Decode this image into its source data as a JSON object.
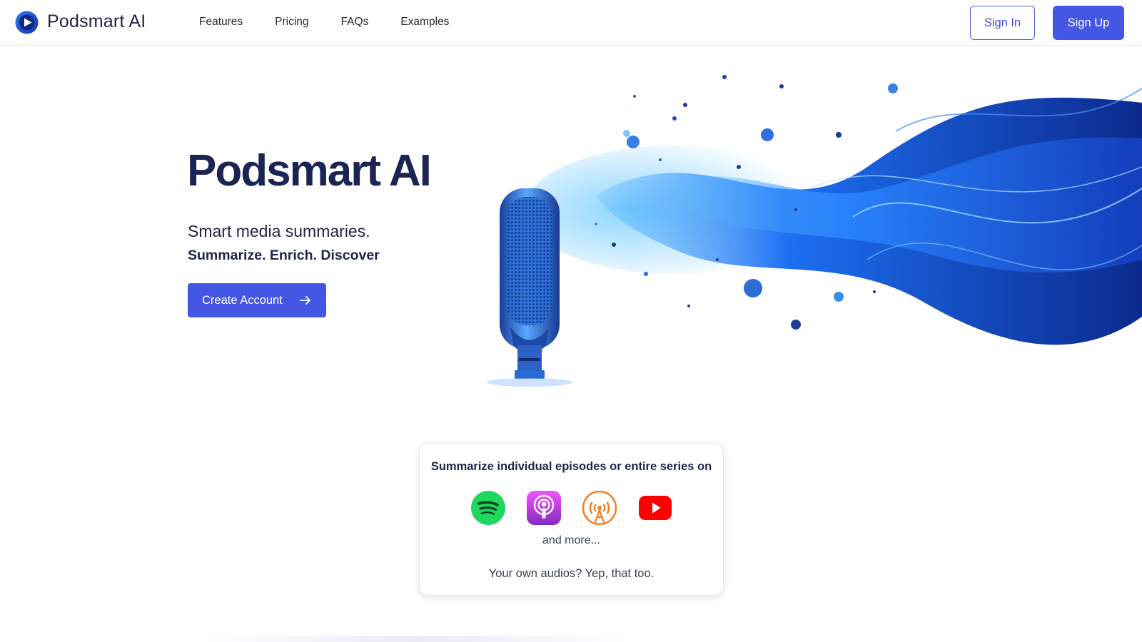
{
  "header": {
    "brand": "Podsmart AI",
    "nav": [
      "Features",
      "Pricing",
      "FAQs",
      "Examples"
    ],
    "sign_in": "Sign In",
    "sign_up": "Sign Up"
  },
  "hero": {
    "title": "Podsmart AI",
    "subtitle": "Smart media summaries.",
    "tagline": "Summarize. Enrich. Discover",
    "cta": "Create Account",
    "cta_icon": "arrow-right-icon",
    "image": "microphone-sound-wave-illustration"
  },
  "platforms": {
    "title": "Summarize individual episodes or entire series on",
    "icons": [
      "spotify-icon",
      "apple-podcasts-icon",
      "overcast-icon",
      "youtube-icon"
    ],
    "more": "and more...",
    "own_audio": "Your own audios? Yep, that too."
  },
  "colors": {
    "primary": "#4457e4",
    "heading": "#1b2453",
    "spotify": "#1ed760",
    "apple_podcasts": "#a445e6",
    "overcast": "#f47e20",
    "youtube": "#ff0000"
  }
}
